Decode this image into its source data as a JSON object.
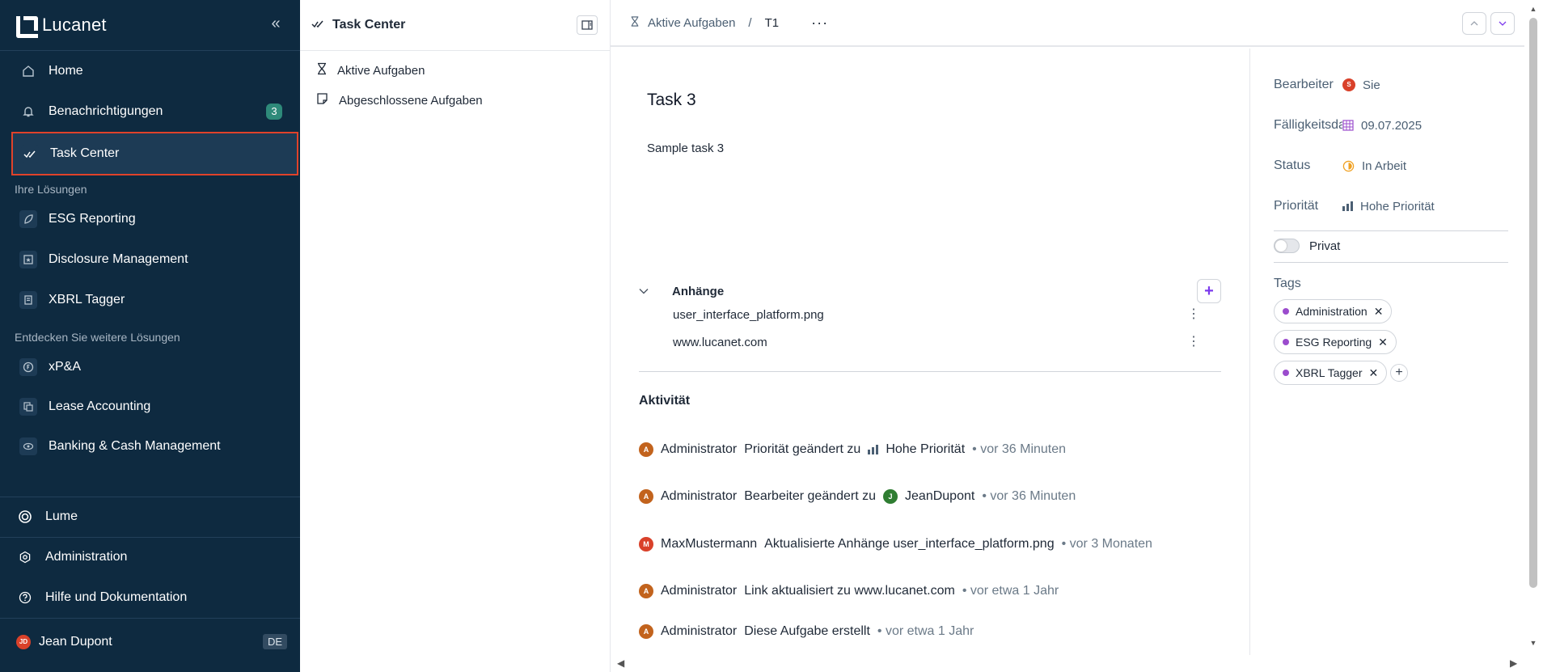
{
  "brand": {
    "name": "Lucanet"
  },
  "nav": {
    "items": [
      {
        "label": "Home"
      },
      {
        "label": "Benachrichtigungen",
        "badge": "3"
      },
      {
        "label": "Task Center"
      }
    ],
    "section_solutions": "Ihre Lösungen",
    "solutions": [
      {
        "label": "ESG Reporting"
      },
      {
        "label": "Disclosure Management"
      },
      {
        "label": "XBRL Tagger"
      }
    ],
    "section_discover": "Entdecken Sie weitere Lösungen",
    "discover": [
      {
        "label": "xP&A"
      },
      {
        "label": "Lease Accounting"
      },
      {
        "label": "Banking & Cash Management"
      }
    ],
    "bottom": [
      {
        "label": "Lume"
      },
      {
        "label": "Administration"
      },
      {
        "label": "Hilfe und Dokumentation"
      }
    ],
    "user": {
      "initials": "JD",
      "name": "Jean Dupont",
      "lang": "DE"
    }
  },
  "middle": {
    "title": "Task Center",
    "items": [
      {
        "label": "Aktive Aufgaben"
      },
      {
        "label": "Abgeschlossene Aufgaben"
      }
    ]
  },
  "breadcrumb": {
    "parent": "Aktive Aufgaben",
    "separator": "/",
    "current": "T1",
    "more": "···"
  },
  "task": {
    "title": "Task 3",
    "description": "Sample task 3",
    "attachments_label": "Anhänge",
    "attachments": [
      {
        "name": "user_interface_platform.png"
      },
      {
        "name": "www.lucanet.com"
      }
    ],
    "activity_label": "Aktivität",
    "activity": [
      {
        "initial": "A",
        "user": "Administrator",
        "action": "Priorität geändert zu",
        "target": "Hohe Priorität",
        "time": "• vor 36 Minuten"
      },
      {
        "initial": "A",
        "user": "Administrator",
        "action": "Bearbeiter geändert zu",
        "target_initial": "J",
        "target": "JeanDupont",
        "time": "• vor 36 Minuten"
      },
      {
        "initial": "M",
        "user": "MaxMustermann",
        "action": "Aktualisierte Anhänge user_interface_platform.png",
        "time": "• vor 3 Monaten"
      },
      {
        "initial": "A",
        "user": "Administrator",
        "action": "Link aktualisiert zu www.lucanet.com",
        "time": "• vor etwa 1 Jahr"
      },
      {
        "initial": "A",
        "user": "Administrator",
        "action": "Diese Aufgabe erstellt",
        "time": "• vor etwa 1 Jahr"
      }
    ]
  },
  "properties": {
    "assignee_label": "Bearbeiter",
    "assignee_initial": "S",
    "assignee": "Sie",
    "due_label": "Fälligkeitsdatum",
    "due": "09.07.2025",
    "status_label": "Status",
    "status": "In Arbeit",
    "priority_label": "Priorität",
    "priority": "Hohe Priorität",
    "private_label": "Privat",
    "tags_label": "Tags",
    "tags": [
      {
        "label": "Administration"
      },
      {
        "label": "ESG Reporting"
      },
      {
        "label": "XBRL Tagger"
      }
    ]
  },
  "colors": {
    "sidebar_bg": "#0e2a40",
    "active_outline": "#e0422a",
    "badge": "#2e8a7a",
    "accent": "#7c3aed",
    "tag_dot": "#9b4ccd"
  }
}
